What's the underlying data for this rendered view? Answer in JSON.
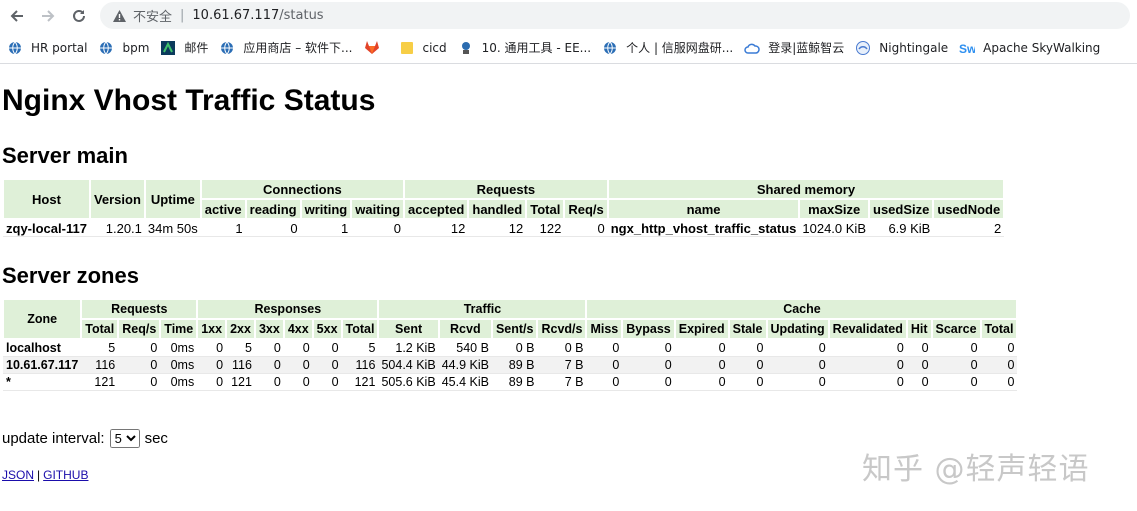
{
  "browser": {
    "insecure_label": "不安全",
    "url_host": "10.61.67.117",
    "url_path": "/status",
    "bookmarks": [
      "HR portal",
      "bpm",
      "邮件",
      "应用商店 – 软件下...",
      "",
      "cicd",
      "10. 通用工具 - EE...",
      "个人 | 信服网盘研...",
      "登录|蓝鲸智云",
      "Nightingale",
      "Apache SkyWalking"
    ]
  },
  "page": {
    "title": "Nginx Vhost Traffic Status",
    "server_main_heading": "Server main",
    "server_zones_heading": "Server zones"
  },
  "server_main": {
    "group_headers": {
      "host": "Host",
      "version": "Version",
      "uptime": "Uptime",
      "connections": "Connections",
      "requests": "Requests",
      "shared_memory": "Shared memory"
    },
    "sub_headers": [
      "active",
      "reading",
      "writing",
      "waiting",
      "accepted",
      "handled",
      "Total",
      "Req/s",
      "name",
      "maxSize",
      "usedSize",
      "usedNode"
    ],
    "row": [
      "zqy-local-117",
      "1.20.1",
      "34m 50s",
      "1",
      "0",
      "1",
      "0",
      "12",
      "12",
      "122",
      "0",
      "ngx_http_vhost_traffic_status",
      "1024.0 KiB",
      "6.9 KiB",
      "2"
    ]
  },
  "server_zones": {
    "group_headers": {
      "zone": "Zone",
      "requests": "Requests",
      "responses": "Responses",
      "traffic": "Traffic",
      "cache": "Cache"
    },
    "sub_headers": [
      "Total",
      "Req/s",
      "Time",
      "1xx",
      "2xx",
      "3xx",
      "4xx",
      "5xx",
      "Total",
      "Sent",
      "Rcvd",
      "Sent/s",
      "Rcvd/s",
      "Miss",
      "Bypass",
      "Expired",
      "Stale",
      "Updating",
      "Revalidated",
      "Hit",
      "Scarce",
      "Total"
    ],
    "rows": [
      [
        "localhost",
        "5",
        "0",
        "0ms",
        "0",
        "5",
        "0",
        "0",
        "0",
        "5",
        "1.2 KiB",
        "540 B",
        "0 B",
        "0 B",
        "0",
        "0",
        "0",
        "0",
        "0",
        "0",
        "0",
        "0",
        "0"
      ],
      [
        "10.61.67.117",
        "116",
        "0",
        "0ms",
        "0",
        "116",
        "0",
        "0",
        "0",
        "116",
        "504.4 KiB",
        "44.9 KiB",
        "89 B",
        "7 B",
        "0",
        "0",
        "0",
        "0",
        "0",
        "0",
        "0",
        "0",
        "0"
      ],
      [
        "*",
        "121",
        "0",
        "0ms",
        "0",
        "121",
        "0",
        "0",
        "0",
        "121",
        "505.6 KiB",
        "45.4 KiB",
        "89 B",
        "7 B",
        "0",
        "0",
        "0",
        "0",
        "0",
        "0",
        "0",
        "0",
        "0"
      ]
    ]
  },
  "controls": {
    "interval_label": "update interval:",
    "interval_value": "5",
    "interval_unit": "sec",
    "json_link": "JSON",
    "github_link": "GITHUB",
    "separator": "|"
  },
  "watermark": "知乎 @轻声轻语",
  "icons": {
    "back": "arrow-left-icon",
    "forward": "arrow-right-icon",
    "reload": "reload-icon",
    "warning": "warning-icon",
    "bookmark_icons": [
      "globe-icon",
      "globe-icon",
      "mail-icon",
      "globe-icon",
      "gitlab-icon",
      "folder-icon",
      "tool-icon",
      "globe-icon",
      "cloud-icon",
      "nightingale-icon",
      "skywalking-icon"
    ]
  },
  "colors": {
    "header_bg": "#dff0d8",
    "row_alt": "#f2f2f2",
    "link": "#1a0dab"
  }
}
